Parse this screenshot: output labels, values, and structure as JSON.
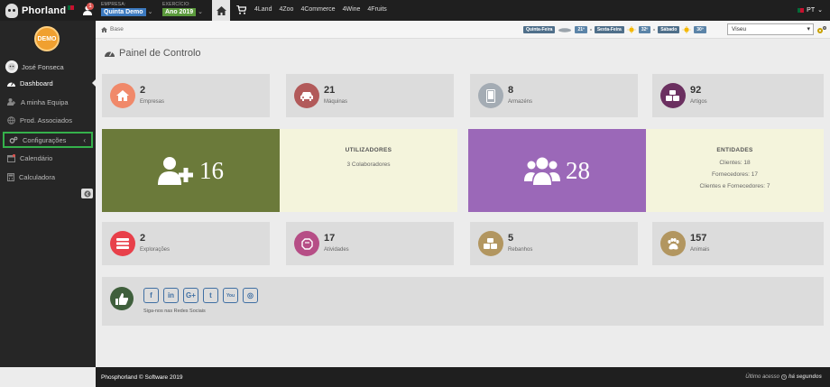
{
  "brand": {
    "name": "Phorland"
  },
  "header": {
    "notif_count": "1",
    "empresa_label": "Empresa:",
    "empresa_value": "Quinta Demo",
    "exercicio_label": "Exercício:",
    "exercicio_value": "Ano 2019",
    "nav_links": [
      "4Land",
      "4Zoo",
      "4Commerce",
      "4Wine",
      "4Fruits"
    ],
    "language": "PT"
  },
  "sidebar": {
    "demo_badge": "DEMO",
    "user_name": "José Fonseca",
    "items": [
      {
        "label": "Dashboard",
        "icon": "dashboard-icon"
      },
      {
        "label": "A minha Equipa",
        "icon": "team-icon"
      },
      {
        "label": "Prod. Associados",
        "icon": "globe-icon"
      },
      {
        "label": "Configurações",
        "icon": "cogs-icon"
      },
      {
        "label": "Calendário",
        "icon": "calendar-icon"
      },
      {
        "label": "Calculadora",
        "icon": "calculator-icon"
      }
    ]
  },
  "breadcrumb": {
    "label": "Base"
  },
  "weather": {
    "day1": "Quinta-Feira",
    "temp1": "21º",
    "day2": "Sexta-Feira",
    "temp2": "32º",
    "day3": "Sábado",
    "temp3": "30º",
    "location": "Viseu"
  },
  "page_title": "Painel de Controlo",
  "cards_row1": [
    {
      "value": "2",
      "label": "Empresas",
      "color": "#f0896a"
    },
    {
      "value": "21",
      "label": "Máquinas",
      "color": "#b25a5a"
    },
    {
      "value": "8",
      "label": "Armazéns",
      "color": "#a4acb4"
    },
    {
      "value": "92",
      "label": "Artigos",
      "color": "#6b3060"
    }
  ],
  "big_users": {
    "value": "16",
    "title": "UTILIZADORES",
    "line": "3 Colaboradores",
    "color": "#6b7a3a"
  },
  "big_entities": {
    "value": "28",
    "title": "ENTIDADES",
    "lines": [
      "Clientes: 18",
      "Fornecedores: 17",
      "Clientes e Fornecedores: 7"
    ],
    "color": "#9b68b8"
  },
  "cards_row2": [
    {
      "value": "2",
      "label": "Explorações",
      "color": "#e8404a"
    },
    {
      "value": "17",
      "label": "Atividades",
      "color": "#b64e86"
    },
    {
      "value": "5",
      "label": "Rebanhos",
      "color": "#b29660"
    },
    {
      "value": "157",
      "label": "Animais",
      "color": "#b29660"
    }
  ],
  "social": {
    "icons": [
      "facebook-icon",
      "linkedin-icon",
      "google-plus-icon",
      "twitter-icon",
      "youtube-icon",
      "instagram-icon"
    ],
    "glyphs": [
      "f",
      "in",
      "G+",
      "t",
      "You",
      "◎"
    ],
    "text": "Siga-nos nas Redes Sociais"
  },
  "footer": {
    "copyright": "Phosphorland © Software 2019",
    "last_access_label": "Último acesso",
    "last_access_value": "há segundos"
  }
}
